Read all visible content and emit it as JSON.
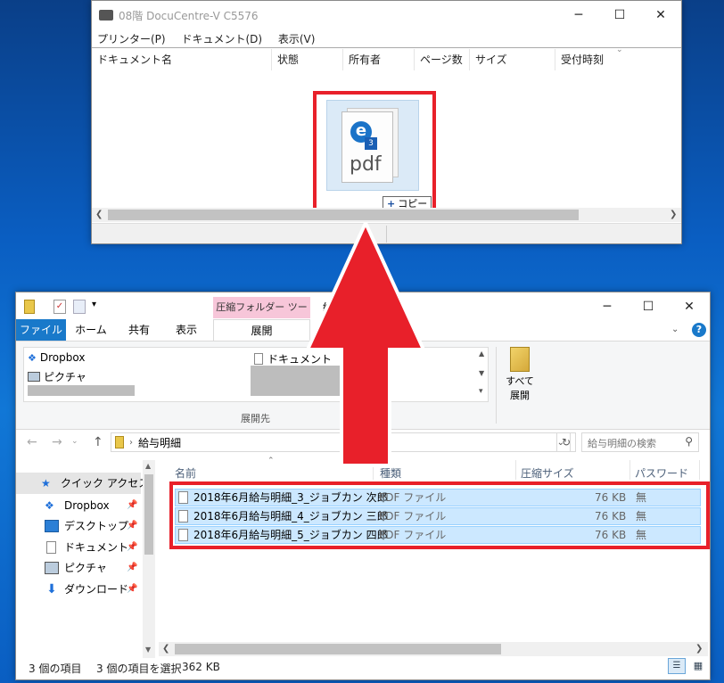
{
  "printer": {
    "title": "08階 DocuCentre-V C5576",
    "menu": [
      "プリンター(P)",
      "ドキュメント(D)",
      "表示(V)"
    ],
    "columns": [
      "ドキュメント名",
      "状態",
      "所有者",
      "ページ数",
      "サイズ",
      "受付時刻"
    ],
    "drag_icon_label": "pdf",
    "drag_icon_badge": "3",
    "copy_tooltip": "コピー"
  },
  "explorer": {
    "ribbon_context_tab": "圧縮フォルダー ツール",
    "title_fragment": "給",
    "tabs": [
      "ファイル",
      "ホーム",
      "共有",
      "表示",
      "展開"
    ],
    "dest_items": [
      "Dropbox",
      "ドキュメント",
      "ピクチャ"
    ],
    "extract_all": [
      "すべて",
      "展開"
    ],
    "group_label": "展開先",
    "address": "給与明細",
    "search_placeholder": "給与明細の検索",
    "columns": [
      "名前",
      "種類",
      "圧縮サイズ",
      "パスワード"
    ],
    "nav": [
      {
        "label": "クイック アクセス",
        "icon": "star-icon"
      },
      {
        "label": "Dropbox",
        "icon": "dropbox-icon"
      },
      {
        "label": "デスクトップ",
        "icon": "desktop-icon"
      },
      {
        "label": "ドキュメント",
        "icon": "document-icon"
      },
      {
        "label": "ピクチャ",
        "icon": "picture-icon"
      },
      {
        "label": "ダウンロード",
        "icon": "download-icon"
      }
    ],
    "files": [
      {
        "name": "2018年6月給与明細_3_ジョブカン 次郎",
        "type": "PDF ファイル",
        "size": "76 KB",
        "password": "無"
      },
      {
        "name": "2018年6月給与明細_4_ジョブカン 三郎",
        "type": "PDF ファイル",
        "size": "76 KB",
        "password": "無"
      },
      {
        "name": "2018年6月給与明細_5_ジョブカン 四郎",
        "type": "PDF ファイル",
        "size": "76 KB",
        "password": "無"
      }
    ],
    "status_count": "3 個の項目",
    "status_selected": "3 個の項目を選択",
    "status_size": "362 KB"
  },
  "colors": {
    "highlight": "#e8202a",
    "arrow": "#e8202a",
    "selection": "#cce8ff",
    "context_tab": "#f7c6d9"
  }
}
